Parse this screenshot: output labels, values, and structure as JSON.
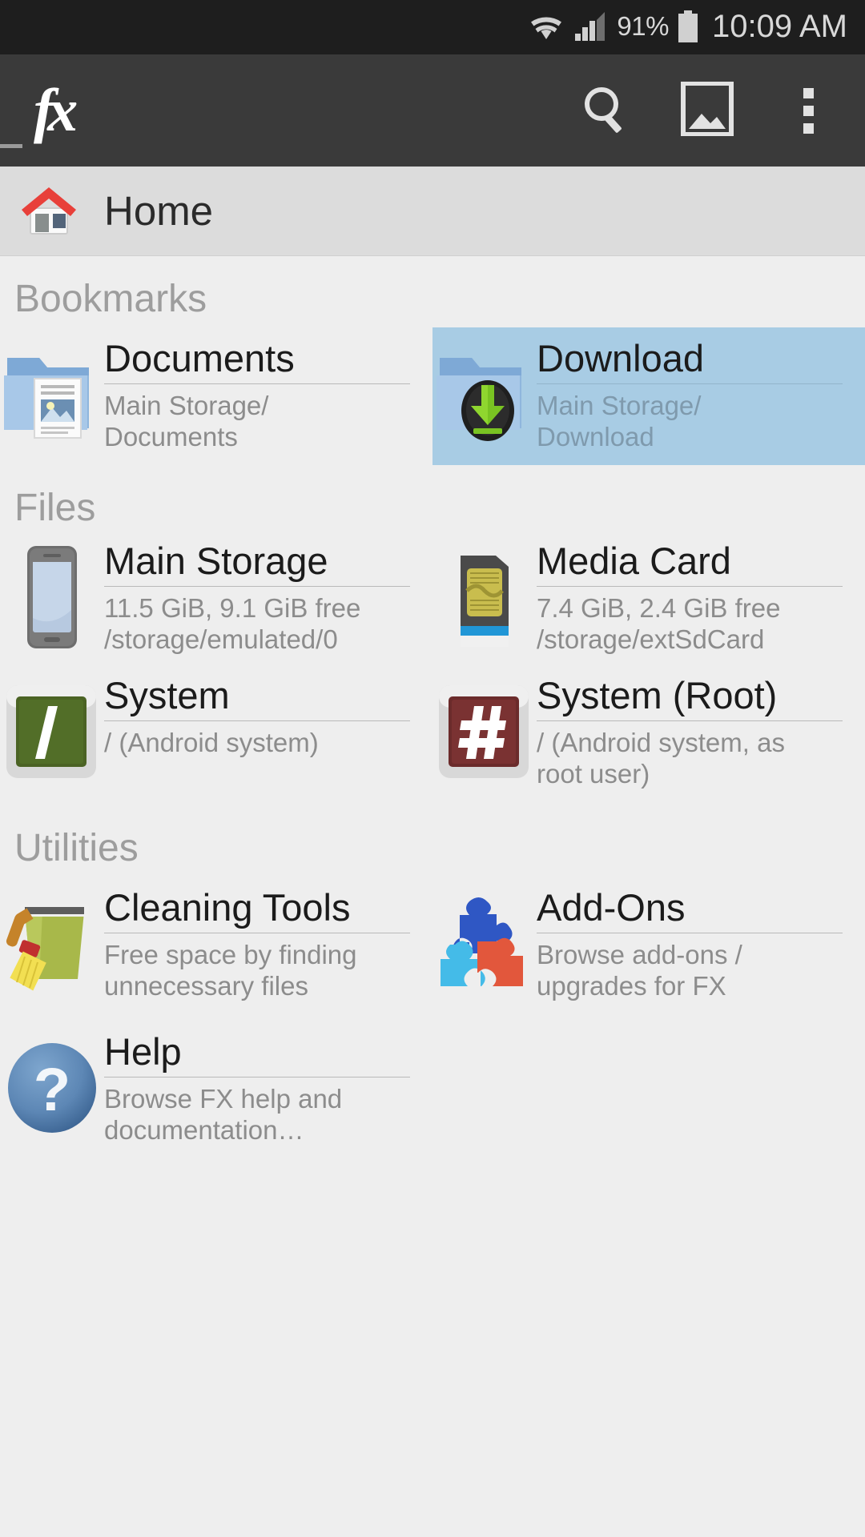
{
  "status_bar": {
    "wifi_icon": "wifi-icon",
    "signal_icon": "cell-signal-icon",
    "battery_percent": "91%",
    "battery_icon": "battery-icon",
    "clock": "10:09 AM"
  },
  "action_bar": {
    "drawer_icon": "drawer-dash-icon",
    "logo_text": "fx",
    "search_icon": "search-icon",
    "gallery_icon": "image-icon",
    "overflow_icon": "overflow-menu-icon"
  },
  "breadcrumb": {
    "home_icon": "home-icon",
    "label": "Home"
  },
  "sections": [
    {
      "id": "bookmarks",
      "header": "Bookmarks",
      "items": [
        {
          "icon": "folder-documents-icon",
          "title": "Documents",
          "subtitle": "Main Storage/\nDocuments",
          "selected": false
        },
        {
          "icon": "folder-download-icon",
          "title": "Download",
          "subtitle": "Main Storage/\nDownload",
          "selected": true
        }
      ]
    },
    {
      "id": "files",
      "header": "Files",
      "items": [
        {
          "icon": "phone-storage-icon",
          "title": "Main Storage",
          "subtitle": "11.5 GiB, 9.1 GiB free\n/storage/emulated/0",
          "selected": false
        },
        {
          "icon": "sd-card-icon",
          "title": "Media Card",
          "subtitle": "7.4 GiB, 2.4 GiB free\n/storage/extSdCard",
          "selected": false
        },
        {
          "icon": "system-root-slash-icon",
          "title": "System",
          "subtitle": "/ (Android system)",
          "selected": false
        },
        {
          "icon": "system-root-hash-icon",
          "title": "System (Root)",
          "subtitle": "/ (Android system, as\nroot user)",
          "selected": false
        }
      ]
    },
    {
      "id": "utilities",
      "header": "Utilities",
      "items": [
        {
          "icon": "cleaning-broom-icon",
          "title": "Cleaning Tools",
          "subtitle": "Free space by finding\nunnecessary files",
          "selected": false
        },
        {
          "icon": "puzzle-addons-icon",
          "title": "Add-Ons",
          "subtitle": "Browse add-ons /\nupgrades for FX",
          "selected": false
        },
        {
          "icon": "help-question-icon",
          "title": "Help",
          "subtitle": "Browse FX help and\ndocumentation…",
          "selected": false
        }
      ]
    }
  ],
  "colors": {
    "status_bar_bg": "#1e1e1e",
    "action_bar_bg": "#3a3a3a",
    "breadcrumb_bg": "#dcdcdc",
    "content_bg": "#eeeeee",
    "selection_bg": "#a8cce4",
    "title_text": "#1b1b1b",
    "subtitle_text": "#8c8c8c",
    "section_header_text": "#9d9d9d",
    "home_roof_red": "#e8403a"
  }
}
